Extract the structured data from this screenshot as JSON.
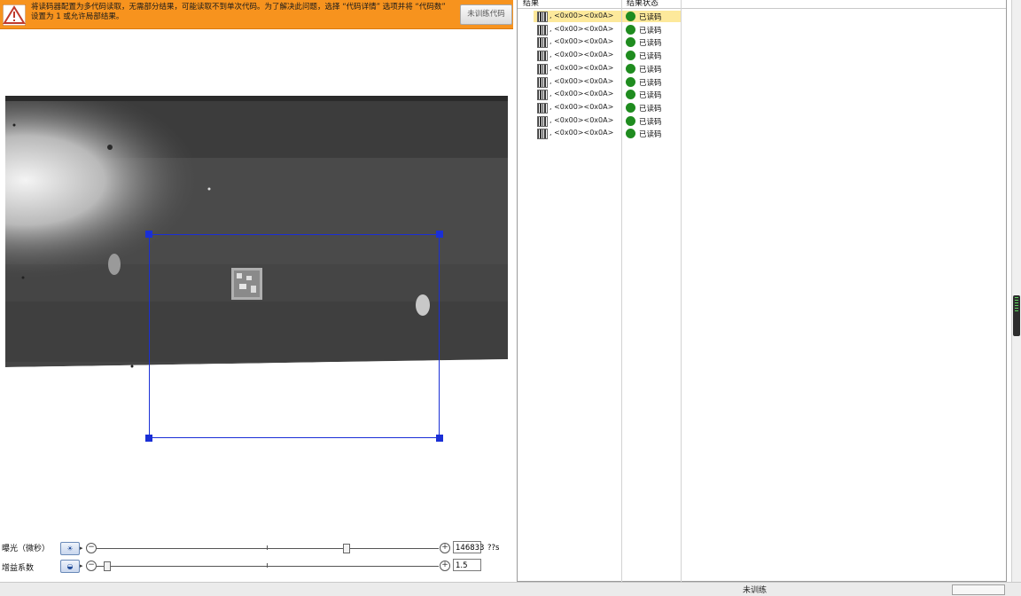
{
  "banner": {
    "icon": "warning-triangle-icon",
    "message": "将读码器配置为多代码读取，无需部分结果，可能读取不到单次代码。为了解决此问题，选择 “代码详情” 选项并将 “代码数” 设置为 1 或允许局部结果。",
    "button_label": "未训练代码"
  },
  "camera": {
    "image_label": "camera-view"
  },
  "exposure": {
    "label": "曝光（微秒）",
    "value": "146833",
    "unit": "??s",
    "slider_level": 0.73
  },
  "gain": {
    "label": "增益系数",
    "value": "1.5",
    "slider_level": 0.03
  },
  "results": {
    "col_result": "结果",
    "col_status": "结果状态",
    "rows": [
      {
        "result": ", <0x00><0x0A>",
        "status": "已读码",
        "selected": true
      },
      {
        "result": ", <0x00><0x0A>",
        "status": "已读码",
        "selected": false
      },
      {
        "result": ", <0x00><0x0A>",
        "status": "已读码",
        "selected": false
      },
      {
        "result": ", <0x00><0x0A>",
        "status": "已读码",
        "selected": false
      },
      {
        "result": ", <0x00><0x0A>",
        "status": "已读码",
        "selected": false
      },
      {
        "result": ", <0x00><0x0A>",
        "status": "已读码",
        "selected": false
      },
      {
        "result": ", <0x00><0x0A>",
        "status": "已读码",
        "selected": false
      },
      {
        "result": ", <0x00><0x0A>",
        "status": "已读码",
        "selected": false
      },
      {
        "result": ", <0x00><0x0A>",
        "status": "已读码",
        "selected": false
      },
      {
        "result": ", <0x00><0x0A>",
        "status": "已读码",
        "selected": false
      }
    ]
  },
  "statusbar": {
    "text": "未训练"
  },
  "colors": {
    "banner": "#f7931e",
    "roi": "#1a2fd6",
    "selected_row": "#fde99b",
    "status_ok": "#1f8c1f"
  }
}
